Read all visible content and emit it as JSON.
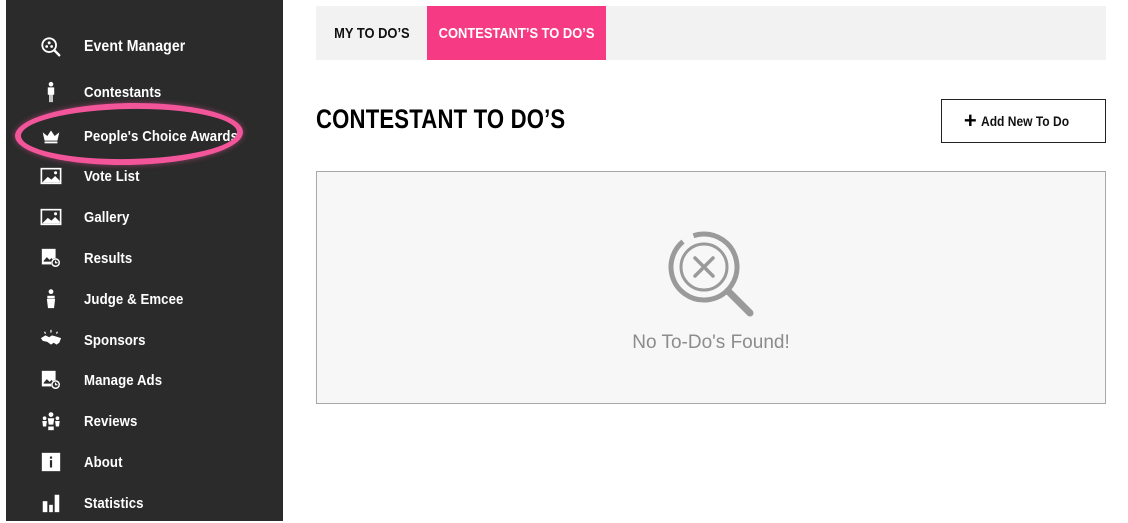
{
  "sidebar": {
    "items": [
      {
        "label": "Event Manager",
        "icon": "search-people-icon"
      },
      {
        "label": "Contestants",
        "icon": "person-icon"
      },
      {
        "label": "People's Choice Awards",
        "icon": "crown-icon"
      },
      {
        "label": "Vote List",
        "icon": "image-icon"
      },
      {
        "label": "Gallery",
        "icon": "image-icon"
      },
      {
        "label": "Results",
        "icon": "image-clock-icon"
      },
      {
        "label": "Judge & Emcee",
        "icon": "podium-icon"
      },
      {
        "label": "Sponsors",
        "icon": "handshake-icon"
      },
      {
        "label": "Manage Ads",
        "icon": "image-clock-icon"
      },
      {
        "label": "Reviews",
        "icon": "people-group-icon"
      },
      {
        "label": "About",
        "icon": "info-icon"
      },
      {
        "label": "Statistics",
        "icon": "bar-chart-icon"
      }
    ]
  },
  "tabs": {
    "my_todos": "MY TO DO’S",
    "contestant_todos": "CONTESTANT’S TO DO’S",
    "active": "contestant_todos"
  },
  "main": {
    "title": "CONTESTANT TO DO’S",
    "add_button_label": "Add New To Do",
    "empty_message": "No To-Do's Found!"
  },
  "colors": {
    "sidebar_bg": "#2b2b2b",
    "accent_pink": "#f63b84",
    "highlight_ring": "#f2559a"
  }
}
